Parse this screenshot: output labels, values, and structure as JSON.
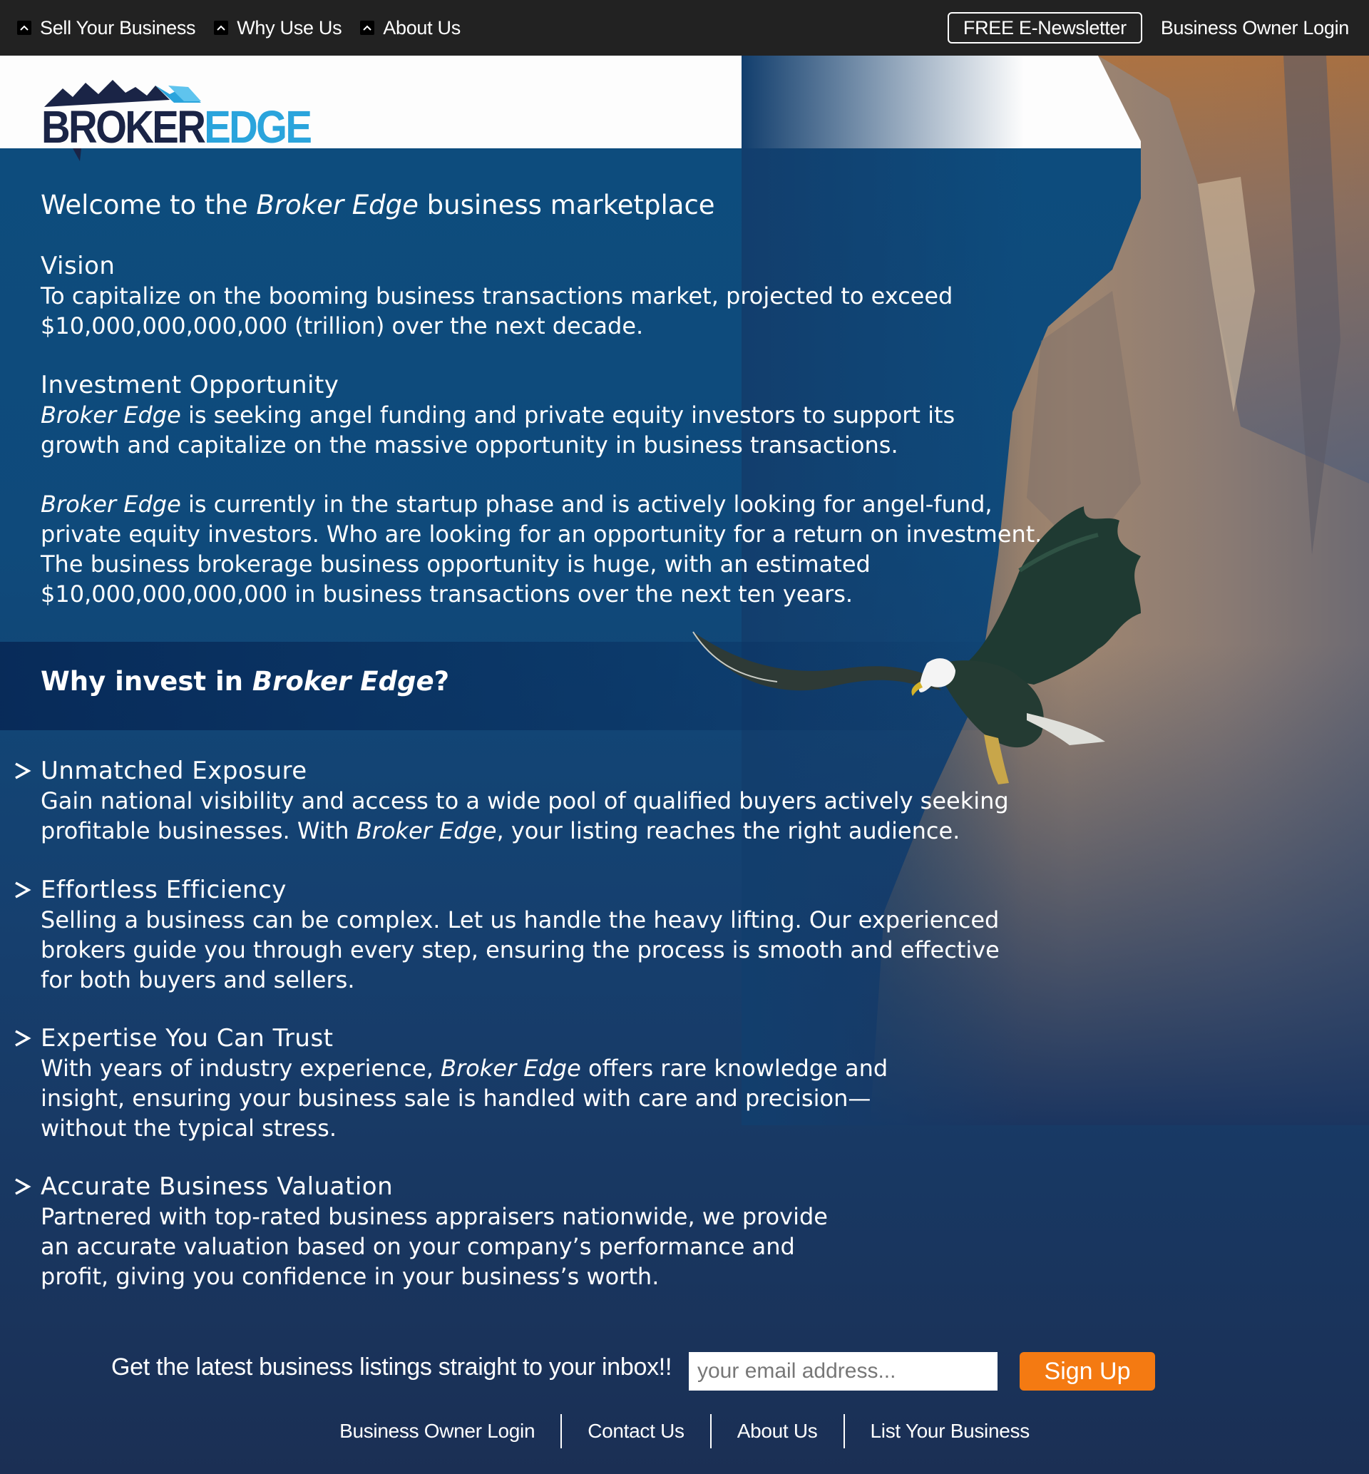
{
  "nav": {
    "items": [
      {
        "label": "Sell Your Business"
      },
      {
        "label": "Why Use Us"
      },
      {
        "label": "About Us"
      }
    ],
    "newsletter_label": "FREE E-Newsletter",
    "login_label": "Business Owner Login"
  },
  "logo": {
    "broker": "BROKER",
    "edge": "EDGE"
  },
  "welcome": {
    "prefix": "Welcome to the ",
    "brand": "Broker Edge",
    "suffix": " business marketplace"
  },
  "vision": {
    "title": "Vision",
    "lines": [
      "To capitalize on the booming business transactions market, projected to exceed",
      "$10,000,000,000,000 (trillion) over the next decade."
    ]
  },
  "investment": {
    "title": "Investment Opportunity",
    "brand": "Broker Edge",
    "line1_rest": " is seeking angel funding and private equity investors to support its",
    "line2": "growth and capitalize on the massive opportunity in business transactions."
  },
  "startup": {
    "brand": "Broker Edge",
    "line1_rest": " is currently in the startup phase and is actively looking for angel-fund,",
    "line2": "private equity investors. Who are looking for an opportunity for a return on investment.",
    "line3": "The business brokerage business opportunity is huge, with an estimated",
    "line4": "$10,000,000,000,000 in business transactions over the next ten years."
  },
  "why": {
    "prefix": "Why invest in ",
    "brand": "Broker Edge",
    "suffix": "?"
  },
  "features": [
    {
      "title": "Unmatched Exposure",
      "line1": "Gain national visibility and access to a wide pool of qualified buyers actively seeking",
      "line2_pre": "profitable businesses. With ",
      "line2_brand": "Broker Edge",
      "line2_post": ", your listing reaches the right audience."
    },
    {
      "title": "Effortless Efficiency",
      "line1": "Selling a business can be complex. Let us handle the heavy lifting. Our experienced",
      "line2": "brokers guide you through every step, ensuring the process is smooth and effective",
      "line3": "for both buyers and sellers."
    },
    {
      "title": "Expertise You Can Trust",
      "line1_pre": "With years of industry experience, ",
      "line1_brand": "Broker Edge",
      "line1_post": " offers rare knowledge and",
      "line2": "insight, ensuring your business sale is handled with care and precision—",
      "line3": "without the typical stress."
    },
    {
      "title": "Accurate Business Valuation",
      "line1": "Partnered with top-rated business appraisers nationwide, we provide",
      "line2": "an accurate valuation based on your company’s performance and",
      "line3": "profit, giving you confidence in your business’s worth."
    }
  ],
  "signup": {
    "label": "Get the latest business listings straight to your inbox!!",
    "placeholder": "your email address...",
    "button": "Sign Up"
  },
  "footer": {
    "links": [
      "Business Owner Login",
      "Contact Us",
      "About Us",
      "List Your Business"
    ]
  },
  "colors": {
    "nav_bg": "#222222",
    "accent_orange": "#f47a12",
    "brand_dark": "#1a2446",
    "brand_light": "#2aa4dc",
    "content_blue": "#0d4c7d"
  }
}
